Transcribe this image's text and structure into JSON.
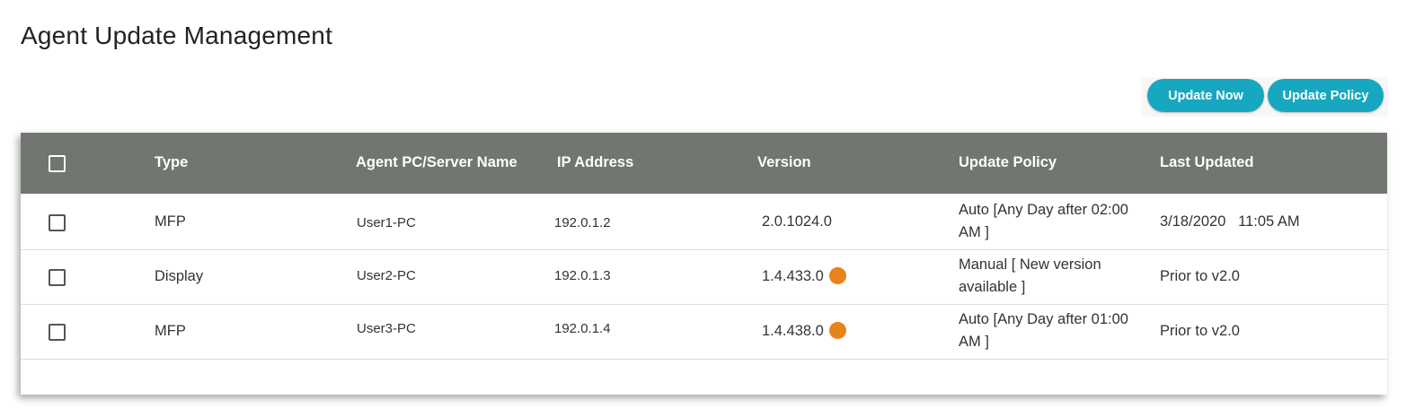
{
  "page": {
    "title": "Agent Update Management"
  },
  "toolbar": {
    "update_now_label": "Update  Now",
    "update_policy_label": "Update Policy"
  },
  "colors": {
    "accent": "#17a7c1",
    "header_bg": "#717670",
    "update_available_dot": "#e8821b"
  },
  "table": {
    "columns": [
      "Type",
      "Agent PC/Server Name",
      "IP Address",
      "Version",
      "Update Policy",
      "Last Updated"
    ],
    "rows": [
      {
        "type": "MFP",
        "name": "User1-PC",
        "ip": "192.0.1.2",
        "version": "2.0.1024.0",
        "update_available": false,
        "policy": "Auto [Any Day after 02:00 AM ]",
        "last_updated": "3/18/2020   11:05 AM"
      },
      {
        "type": "Display",
        "name": "User2-PC",
        "ip": "192.0.1.3",
        "version": "1.4.433.0",
        "update_available": true,
        "policy": "Manual [ New version available ]",
        "last_updated": "Prior to v2.0"
      },
      {
        "type": "MFP",
        "name": "User3-PC",
        "ip": "192.0.1.4",
        "version": "1.4.438.0",
        "update_available": true,
        "policy": "Auto [Any Day after 01:00 AM ]",
        "last_updated": "Prior to v2.0"
      }
    ]
  }
}
